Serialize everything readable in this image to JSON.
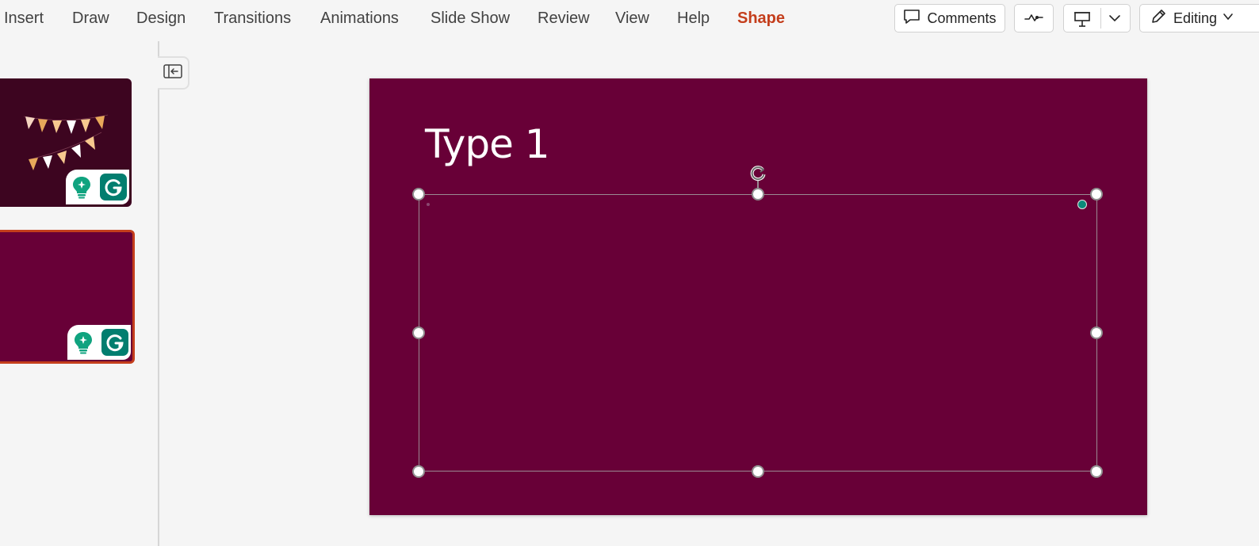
{
  "ribbon": {
    "tabs": [
      {
        "label": "Insert"
      },
      {
        "label": "Draw"
      },
      {
        "label": "Design"
      },
      {
        "label": "Transitions"
      },
      {
        "label": "Animations"
      },
      {
        "label": "Slide Show"
      },
      {
        "label": "Review"
      },
      {
        "label": "View"
      },
      {
        "label": "Help"
      },
      {
        "label": "Shape",
        "active": true
      }
    ],
    "comments_label": "Comments",
    "editing_label": "Editing",
    "icons": {
      "comments": "comment-icon",
      "ink": "ink-replay-icon",
      "present": "present-icon",
      "present_menu": "chevron-down-icon",
      "editing": "pencil-icon",
      "editing_menu": "chevron-down-icon"
    }
  },
  "thumbnails": {
    "collapse_icon": "panel-collapse-icon",
    "slides": [
      {
        "background": "#3d0520",
        "content": "pennant-bunting-icon",
        "selected": false
      },
      {
        "background": "#680037",
        "selected": true
      }
    ],
    "addins": [
      "lightbulb-sparkle-icon",
      "grammarly-icon"
    ]
  },
  "slide": {
    "title": "Type 1",
    "background": "#680037"
  },
  "colors": {
    "accent": "#c43e1c",
    "slide_bg": "#680037",
    "grammarly": "#027e6f",
    "designer_teal": "#10a37f"
  }
}
